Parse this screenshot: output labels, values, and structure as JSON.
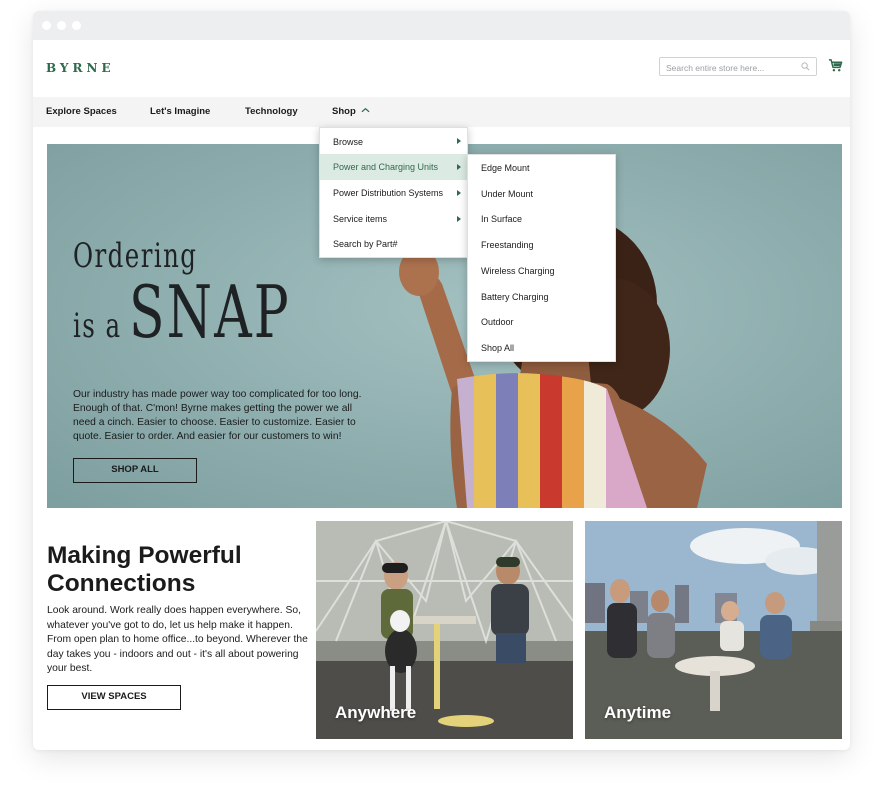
{
  "brand": {
    "logo_text": "BYRNE",
    "accent_color": "#2f6a4d"
  },
  "search": {
    "placeholder": "Search entire store here...",
    "icon": "search-icon"
  },
  "cart": {
    "icon": "cart-icon"
  },
  "nav": {
    "items": [
      {
        "label": "Explore Spaces"
      },
      {
        "label": "Let's Imagine"
      },
      {
        "label": "Technology"
      },
      {
        "label": "Shop",
        "expanded": true
      }
    ]
  },
  "shop_menu": {
    "items": [
      {
        "label": "Browse",
        "has_submenu": true
      },
      {
        "label": "Power and Charging Units",
        "has_submenu": true,
        "active": true
      },
      {
        "label": "Power Distribution Systems",
        "has_submenu": true
      },
      {
        "label": "Service items",
        "has_submenu": true
      },
      {
        "label": "Search by Part#",
        "has_submenu": false
      }
    ]
  },
  "submenu": {
    "items": [
      {
        "label": "Edge Mount"
      },
      {
        "label": "Under Mount"
      },
      {
        "label": "In Surface"
      },
      {
        "label": "Freestanding"
      },
      {
        "label": "Wireless Charging"
      },
      {
        "label": "Battery Charging"
      },
      {
        "label": "Outdoor"
      },
      {
        "label": "Shop All"
      }
    ]
  },
  "hero": {
    "headline_line1": "Ordering",
    "headline_is_a": "is a",
    "headline_snap": "SNAP",
    "body": "Our industry has made power way too complicated for too long. Enough of that. C'mon! Byrne makes getting the power we all need a cinch. Easier to choose. Easier to customize. Easier to quote. Easier to order. And easier for our customers to win!",
    "button_label": "SHOP ALL"
  },
  "connections": {
    "title": "Making Powerful Connections",
    "body": "Look around. Work really does happen everywhere. So, whatever you've got to do, let us help make it happen. From open plan to home office...to beyond. Wherever the day takes you - indoors and out - it's all about powering your best.",
    "button_label": "VIEW SPACES"
  },
  "tiles": [
    {
      "label": "Anywhere"
    },
    {
      "label": "Anytime"
    }
  ]
}
